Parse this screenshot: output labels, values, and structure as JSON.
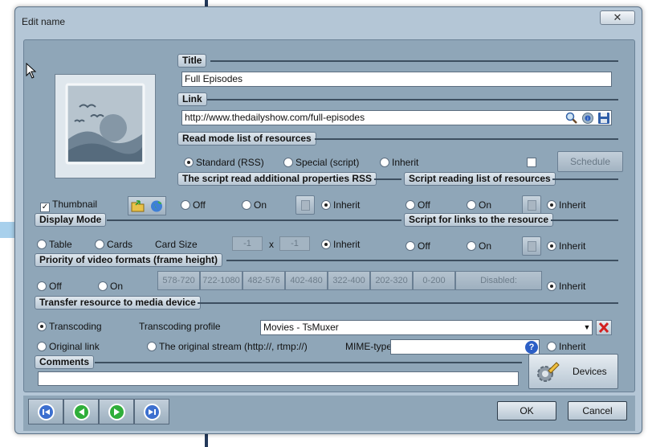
{
  "window": {
    "title": "Edit name",
    "close_glyph": "✕"
  },
  "title_section": {
    "label": "Title",
    "value": "Full Episodes"
  },
  "link_section": {
    "label": "Link",
    "value": "http://www.thedailyshow.com/full-episodes"
  },
  "read_mode": {
    "label": "Read mode list of resources",
    "options": [
      "Standard (RSS)",
      "Special (script)",
      "Inherit"
    ],
    "selected": "Standard (RSS)",
    "schedule_label": "Schedule"
  },
  "thumbnail": {
    "label": "Thumbnail",
    "checked": true
  },
  "script_props": {
    "label": "The script read additional properties RSS",
    "off": "Off",
    "on": "On",
    "inherit": "Inherit",
    "selected": "Inherit"
  },
  "script_list": {
    "label": "Script reading list of resources",
    "off": "Off",
    "on": "On",
    "inherit": "Inherit",
    "selected": "Inherit"
  },
  "display_mode": {
    "label": "Display Mode",
    "table": "Table",
    "cards": "Cards",
    "card_size_label": "Card Size",
    "width": "-1",
    "x": "x",
    "height": "-1",
    "inherit": "Inherit",
    "selected": "Inherit"
  },
  "script_links": {
    "label": "Script for links to the resource",
    "off": "Off",
    "on": "On",
    "inherit": "Inherit",
    "selected": "Inherit"
  },
  "priority": {
    "label": "Priority of video formats (frame height)",
    "off": "Off",
    "on": "On",
    "formats": [
      "578-720",
      "722-1080",
      "482-576",
      "402-480",
      "322-400",
      "202-320",
      "0-200"
    ],
    "disabled_label": "Disabled:",
    "inherit": "Inherit",
    "selected": "Inherit"
  },
  "transfer": {
    "label": "Transfer resource to media device",
    "transcoding": "Transcoding",
    "transcoding_profile_label": "Transcoding profile",
    "profile_value": "Movies - TsMuxer",
    "original_link": "Original link",
    "original_stream": "The original stream (http://, rtmp://)",
    "mime_label": "MIME-type",
    "mime_value": "",
    "inherit": "Inherit",
    "selected": "Transcoding"
  },
  "comments": {
    "label": "Comments",
    "value": ""
  },
  "devices_button": "Devices",
  "ok_button": "OK",
  "cancel_button": "Cancel",
  "colors": {
    "panel": "#8fa6b8",
    "window": "#b4c6d6",
    "nav_circle": "#3c6fcf",
    "nav_circle_green": "#2fae3a",
    "clear_red": "#d32020"
  }
}
